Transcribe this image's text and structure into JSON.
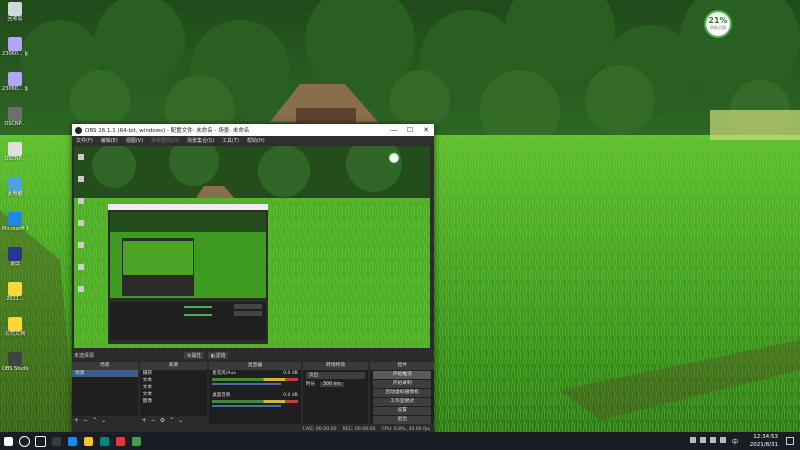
{
  "desktop": {
    "icons": [
      {
        "label": "回收站",
        "color": "#cfd8dc"
      },
      {
        "label": "23060...\n鼠标指针",
        "color": "#b2a3ff"
      },
      {
        "label": "23060...\n鼠标指针",
        "color": "#b2a3ff"
      },
      {
        "label": "OSCNP...",
        "color": "#6e6e6e"
      },
      {
        "label": "OSCNP...",
        "color": "#e0e0e0"
      },
      {
        "label": "此电脑",
        "color": "#4fa3e0"
      },
      {
        "label": "Microsoft Edge",
        "color": "#1e88e5"
      },
      {
        "label": "录屏",
        "color": "#283593"
      },
      {
        "label": "2021...",
        "color": "#fdd835"
      },
      {
        "label": "公司文档",
        "color": "#fdd835"
      },
      {
        "label": "OBS Studio",
        "color": "#424242"
      }
    ],
    "badge": {
      "percent": "21%",
      "sub": "内存占用"
    }
  },
  "obs": {
    "title": "OBS 26.1.1 (64-bit, windows) - 配置文件: 未命名 - 场景: 未命名",
    "window_buttons": [
      "—",
      "☐",
      "✕"
    ],
    "menu": [
      "文件(F)",
      "编辑(E)",
      "视图(V)",
      "停靠部件(D)",
      "场景集合(S)",
      "工具(T)",
      "帮助(H)"
    ],
    "no_source_label": "未选择源",
    "properties_label": "⚙属性",
    "filters_label": "◐滤镜",
    "docks": {
      "scenes": {
        "title": "场景",
        "items": [
          "场景"
        ]
      },
      "sources": {
        "title": "来源",
        "items": [
          "捕获",
          "文本",
          "文本",
          "文本",
          "图像",
          "视频"
        ]
      },
      "mixer": {
        "title": "混音器",
        "channels": [
          {
            "name": "麦克风/Aux",
            "db": "0.0 dB"
          },
          {
            "name": "桌面音频",
            "db": "0.0 dB"
          }
        ]
      },
      "transitions": {
        "title": "转场特效",
        "type": "淡出",
        "duration_label": "时长",
        "duration": "300 ms"
      },
      "controls": {
        "title": "控件",
        "buttons": [
          "开始推流",
          "开始录制",
          "启动虚拟摄像机",
          "工作室模式",
          "设置",
          "退出"
        ]
      }
    },
    "status": {
      "live": "LIVE: 00:00:00",
      "rec": "REC: 00:00:00",
      "cpu": "CPU: 6.8%, 30.00 fps"
    }
  },
  "taskbar": {
    "time": "12:34:53",
    "date": "2021/8/31",
    "lang": "中",
    "apps": [
      {
        "name": "start",
        "color": "#ffffff"
      },
      {
        "name": "search",
        "color": "#ffffff"
      },
      {
        "name": "task-view",
        "color": "#ffffff"
      },
      {
        "name": "obs",
        "color": "#3a3a3a"
      },
      {
        "name": "edge",
        "color": "#1e88e5"
      },
      {
        "name": "explorer",
        "color": "#fbc02d"
      },
      {
        "name": "recorder",
        "color": "#00897b"
      },
      {
        "name": "store",
        "color": "#e53935"
      },
      {
        "name": "wechat",
        "color": "#43a047"
      }
    ]
  }
}
